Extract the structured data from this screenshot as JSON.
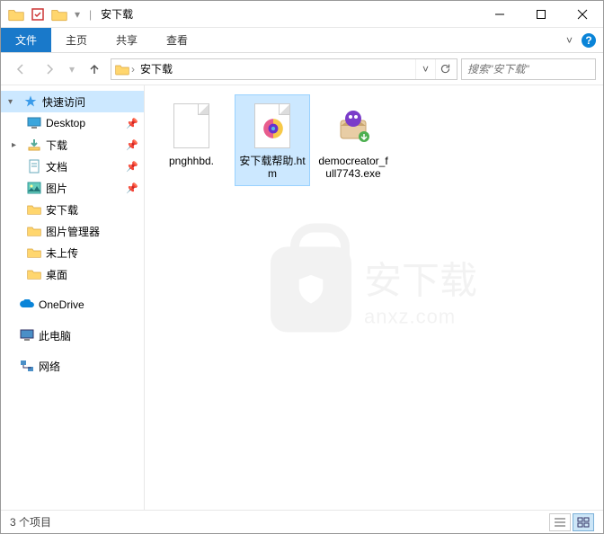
{
  "window": {
    "title": "安下载"
  },
  "ribbon": {
    "tabs": {
      "file": "文件",
      "home": "主页",
      "share": "共享",
      "view": "查看"
    }
  },
  "breadcrumb": {
    "current": "安下载"
  },
  "search": {
    "placeholder": "搜索\"安下载\""
  },
  "sidebar": {
    "quickAccess": "快速访问",
    "items": [
      {
        "label": "Desktop",
        "pin": true
      },
      {
        "label": "下载",
        "pin": true
      },
      {
        "label": "文档",
        "pin": true
      },
      {
        "label": "图片",
        "pin": true
      },
      {
        "label": "安下载",
        "pin": false
      },
      {
        "label": "图片管理器",
        "pin": false
      },
      {
        "label": "未上传",
        "pin": false
      },
      {
        "label": "桌面",
        "pin": false
      }
    ],
    "onedrive": "OneDrive",
    "thispc": "此电脑",
    "network": "网络"
  },
  "files": [
    {
      "label": "pnghhbd."
    },
    {
      "label": "安下载帮助.htm"
    },
    {
      "label": "democreator_full7743.exe"
    }
  ],
  "watermark": {
    "cn": "安下载",
    "en": "anxz.com"
  },
  "status": {
    "count": "3 个项目"
  }
}
